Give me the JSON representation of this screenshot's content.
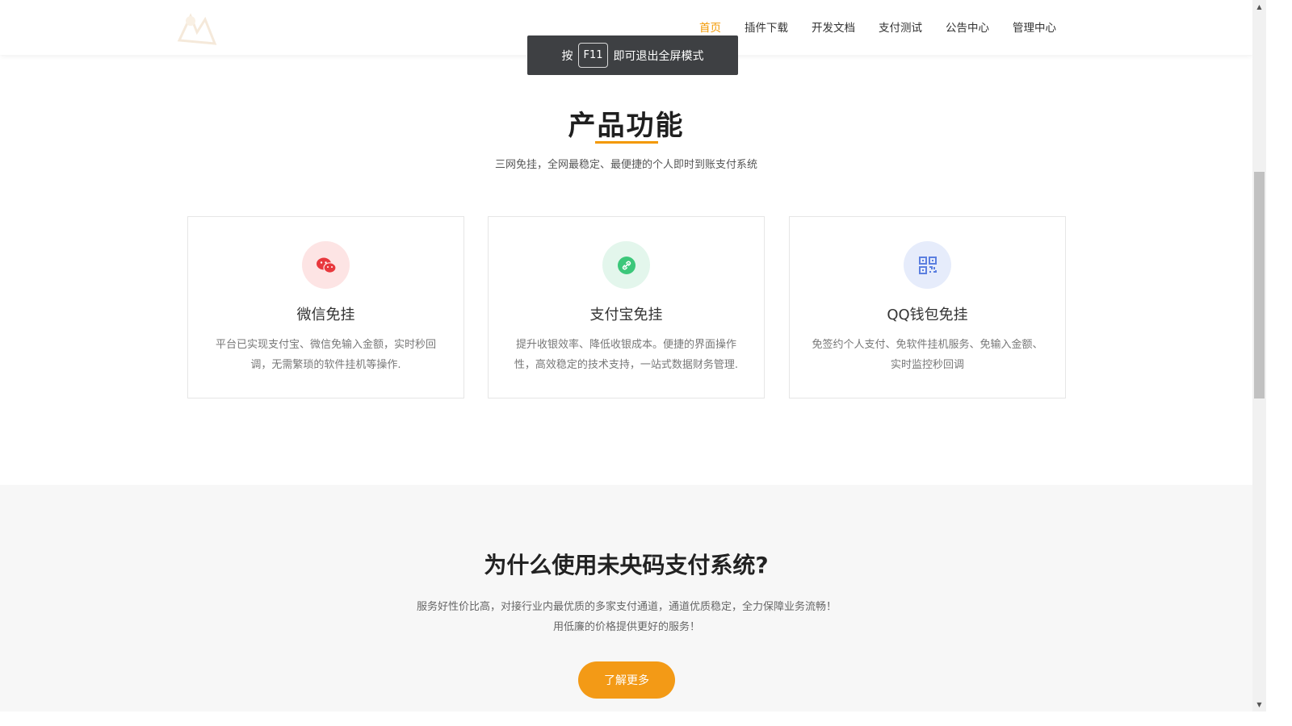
{
  "header": {
    "nav": [
      {
        "label": "首页",
        "active": true
      },
      {
        "label": "插件下载"
      },
      {
        "label": "开发文档"
      },
      {
        "label": "支付测试"
      },
      {
        "label": "公告中心"
      },
      {
        "label": "管理中心"
      }
    ],
    "accent_color": "#f39800"
  },
  "toast": {
    "prefix": "按",
    "key": "F11",
    "suffix": "即可退出全屏模式"
  },
  "features": {
    "title": "产品功能",
    "subtitle": "三网免挂，全网最稳定、最便捷的个人即时到账支付系统",
    "cards": [
      {
        "icon": "wechat-icon",
        "icon_bg": "#fde4e4",
        "icon_color": "#e8383d",
        "title": "微信免挂",
        "desc": "平台已实现支付宝、微信免输入金额，实时秒回调，无需繁琐的软件挂机等操作."
      },
      {
        "icon": "link-icon",
        "icon_bg": "#e3f6ec",
        "icon_color": "#3cc77a",
        "title": "支付宝免挂",
        "desc": "提升收银效率、降低收银成本。便捷的界面操作性，高效稳定的技术支持，一站式数据财务管理."
      },
      {
        "icon": "qrcode-icon",
        "icon_bg": "#e6ecfb",
        "icon_color": "#5b7fe0",
        "title": "QQ钱包免挂",
        "desc": "免签约个人支付、免软件挂机服务、免输入金额、实时监控秒回调"
      }
    ]
  },
  "why": {
    "title": "为什么使用未央码支付系统?",
    "desc": "服务好性价比高，对接行业内最优质的多家支付通道，通道优质稳定，全力保障业务流畅！用低廉的价格提供更好的服务！",
    "button": "了解更多"
  }
}
